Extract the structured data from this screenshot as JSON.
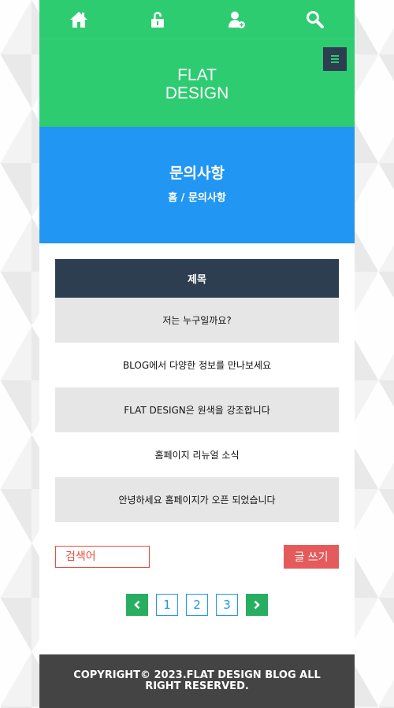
{
  "nav": {
    "items": [
      {
        "icon": "home-icon"
      },
      {
        "icon": "unlock-icon"
      },
      {
        "icon": "add-user-icon"
      },
      {
        "icon": "search-icon"
      }
    ]
  },
  "header": {
    "logo_line1": "FLAT",
    "logo_line2": "DESIGN",
    "menu_icon": "menu-icon"
  },
  "banner": {
    "title": "문의사항",
    "breadcrumb": "홈 / 문의사항"
  },
  "board": {
    "column_header": "제목",
    "rows": [
      "저는 누구일까요?",
      "BLOG에서 다양한 정보를 만나보세요",
      "FLAT DESIGN은 원색을 강조합니다",
      "홈페이지 리뉴얼 소식",
      "안녕하세요 홈페이지가 오픈 되었습니다"
    ]
  },
  "actions": {
    "search_placeholder": "검색어",
    "write_label": "글 쓰기"
  },
  "pager": {
    "prev_icon": "chevron-left-icon",
    "next_icon": "chevron-right-icon",
    "pages": [
      "1",
      "2",
      "3"
    ]
  },
  "footer": {
    "copyright": "COPYRIGHT© 2023.FLAT DESIGN BLOG ALL RIGHT RESERVED."
  },
  "colors": {
    "green": "#2ecc71",
    "navy": "#2c3e50",
    "blue": "#2196f3",
    "red": "#e55b5b",
    "footer": "#444444"
  }
}
